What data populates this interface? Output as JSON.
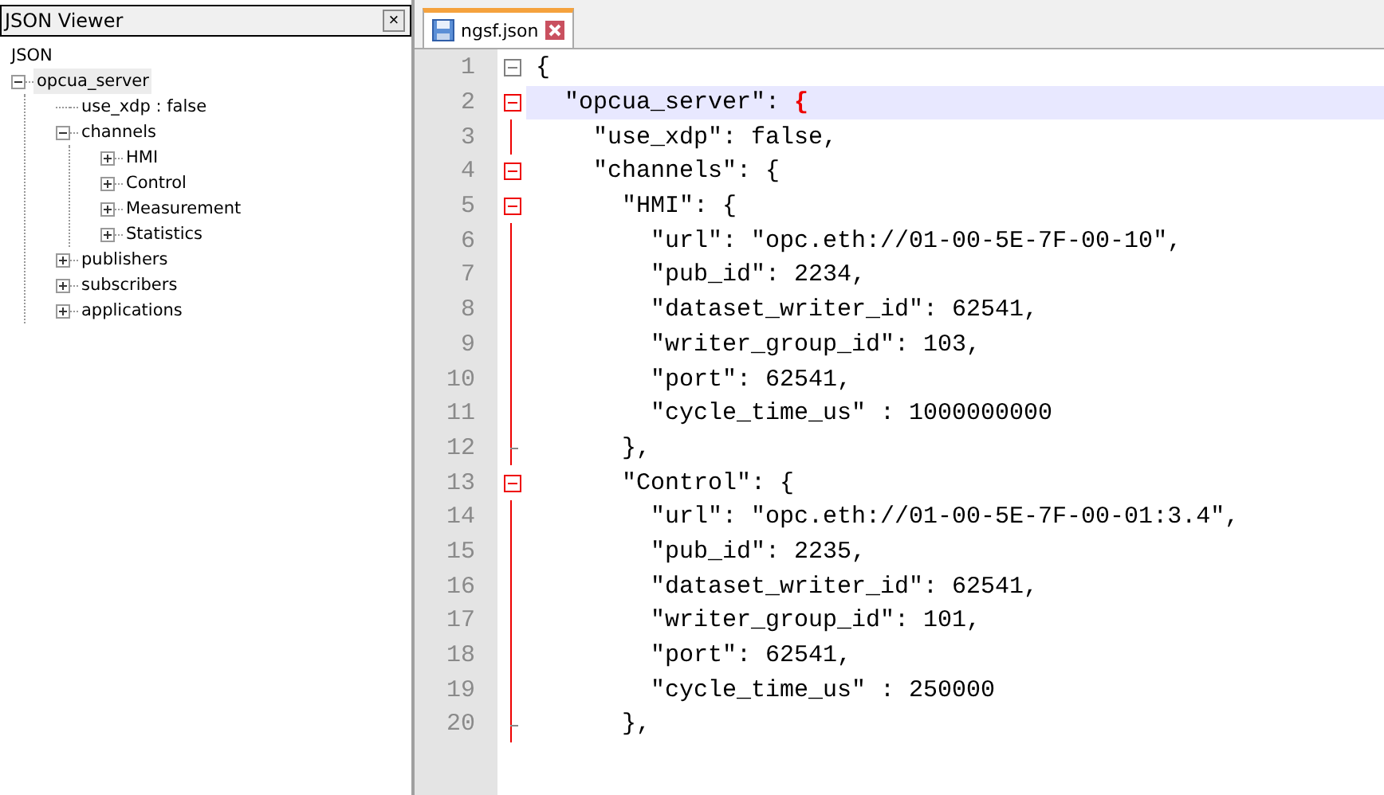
{
  "panel": {
    "title": "JSON Viewer",
    "close": "×"
  },
  "tree": {
    "root": "JSON",
    "nodes": [
      {
        "label": "opcua_server",
        "expanded": true,
        "selected": true,
        "children": [
          {
            "label": "use_xdp : false",
            "kind": "value"
          },
          {
            "label": "channels",
            "kind": "node",
            "expanded": true,
            "selected": false,
            "children": [
              {
                "label": "HMI",
                "expanded": false,
                "selected": false
              },
              {
                "label": "Control",
                "expanded": false,
                "selected": false
              },
              {
                "label": "Measurement",
                "expanded": false,
                "selected": false
              },
              {
                "label": "Statistics",
                "expanded": false,
                "selected": false
              }
            ]
          },
          {
            "label": "publishers",
            "kind": "node",
            "expanded": false,
            "selected": false
          },
          {
            "label": "subscribers",
            "kind": "node",
            "expanded": false,
            "selected": false
          },
          {
            "label": "applications",
            "kind": "node",
            "expanded": false,
            "selected": false
          }
        ]
      }
    ]
  },
  "tabs": [
    {
      "label": "ngsf.json",
      "selected": true
    }
  ],
  "editor": {
    "lines": [
      {
        "num": "1",
        "text": "{",
        "kind": "fold_start",
        "fold_active": false,
        "current": false
      },
      {
        "num": "2",
        "text": "  \"opcua_server\": ",
        "brace": "{",
        "kind": "fold_start",
        "fold_active": true,
        "current": true
      },
      {
        "num": "3",
        "text": "    \"use_xdp\": false,",
        "kind": "fold_body",
        "fold_active": true,
        "current": false
      },
      {
        "num": "4",
        "text": "    \"channels\": {",
        "kind": "fold_start",
        "fold_active": true,
        "current": false
      },
      {
        "num": "5",
        "text": "      \"HMI\": {",
        "kind": "fold_start",
        "fold_active": true,
        "current": false
      },
      {
        "num": "6",
        "text": "        \"url\": \"opc.eth://01-00-5E-7F-00-10\",",
        "kind": "fold_body",
        "fold_active": true,
        "current": false
      },
      {
        "num": "7",
        "text": "        \"pub_id\": 2234,",
        "kind": "fold_body",
        "fold_active": true,
        "current": false
      },
      {
        "num": "8",
        "text": "        \"dataset_writer_id\": 62541,",
        "kind": "fold_body",
        "fold_active": true,
        "current": false
      },
      {
        "num": "9",
        "text": "        \"writer_group_id\": 103,",
        "kind": "fold_body",
        "fold_active": true,
        "current": false
      },
      {
        "num": "10",
        "text": "        \"port\": 62541,",
        "kind": "fold_body",
        "fold_active": true,
        "current": false
      },
      {
        "num": "11",
        "text": "        \"cycle_time_us\" : 1000000000",
        "kind": "fold_body",
        "fold_active": true,
        "current": false
      },
      {
        "num": "12",
        "text": "      },",
        "kind": "fold_end",
        "fold_active": true,
        "current": false
      },
      {
        "num": "13",
        "text": "      \"Control\": {",
        "kind": "fold_start",
        "fold_active": true,
        "current": false
      },
      {
        "num": "14",
        "text": "        \"url\": \"opc.eth://01-00-5E-7F-00-01:3.4\",",
        "kind": "fold_body",
        "fold_active": true,
        "current": false
      },
      {
        "num": "15",
        "text": "        \"pub_id\": 2235,",
        "kind": "fold_body",
        "fold_active": true,
        "current": false
      },
      {
        "num": "16",
        "text": "        \"dataset_writer_id\": 62541,",
        "kind": "fold_body",
        "fold_active": true,
        "current": false
      },
      {
        "num": "17",
        "text": "        \"writer_group_id\": 101,",
        "kind": "fold_body",
        "fold_active": true,
        "current": false
      },
      {
        "num": "18",
        "text": "        \"port\": 62541,",
        "kind": "fold_body",
        "fold_active": true,
        "current": false
      },
      {
        "num": "19",
        "text": "        \"cycle_time_us\" : 250000",
        "kind": "fold_body",
        "fold_active": true,
        "current": false
      },
      {
        "num": "20",
        "text": "      },",
        "kind": "fold_end",
        "fold_active": true,
        "current": false
      }
    ]
  }
}
